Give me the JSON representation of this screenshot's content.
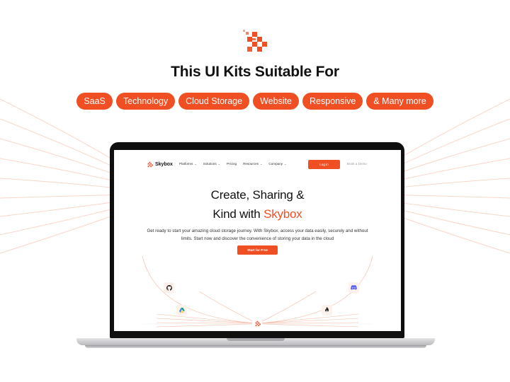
{
  "headline": "This UI Kits Suitable For",
  "tags": [
    "SaaS",
    "Technology",
    "Cloud Storage",
    "Website",
    "Responsive",
    "& Many more"
  ],
  "colors": {
    "accent": "#f04e23",
    "chip_bg": "#fdf1ec",
    "laptop_frame": "#0f0f10"
  },
  "site": {
    "brand": "Skybox",
    "nav": [
      {
        "label": "Platforms",
        "dropdown": true
      },
      {
        "label": "Solutions",
        "dropdown": true
      },
      {
        "label": "Pricing",
        "dropdown": false
      },
      {
        "label": "Resources",
        "dropdown": true
      },
      {
        "label": "Company",
        "dropdown": true
      }
    ],
    "login_label": "Log in",
    "demo_label": "Book a Demo",
    "hero": {
      "title_line1": "Create, Sharing &",
      "title_line2_prefix": "Kind with ",
      "title_line2_accent": "Skybox",
      "description": "Get ready to start your amazing cloud storage journey. With Skybox, access your data easily, securely and without limits. Start now and discover the convenience of storing your data in the cloud",
      "cta_label": "Start for Free"
    },
    "integrations": [
      "github-icon",
      "discord-icon",
      "google-drive-icon",
      "firebase-icon"
    ]
  }
}
